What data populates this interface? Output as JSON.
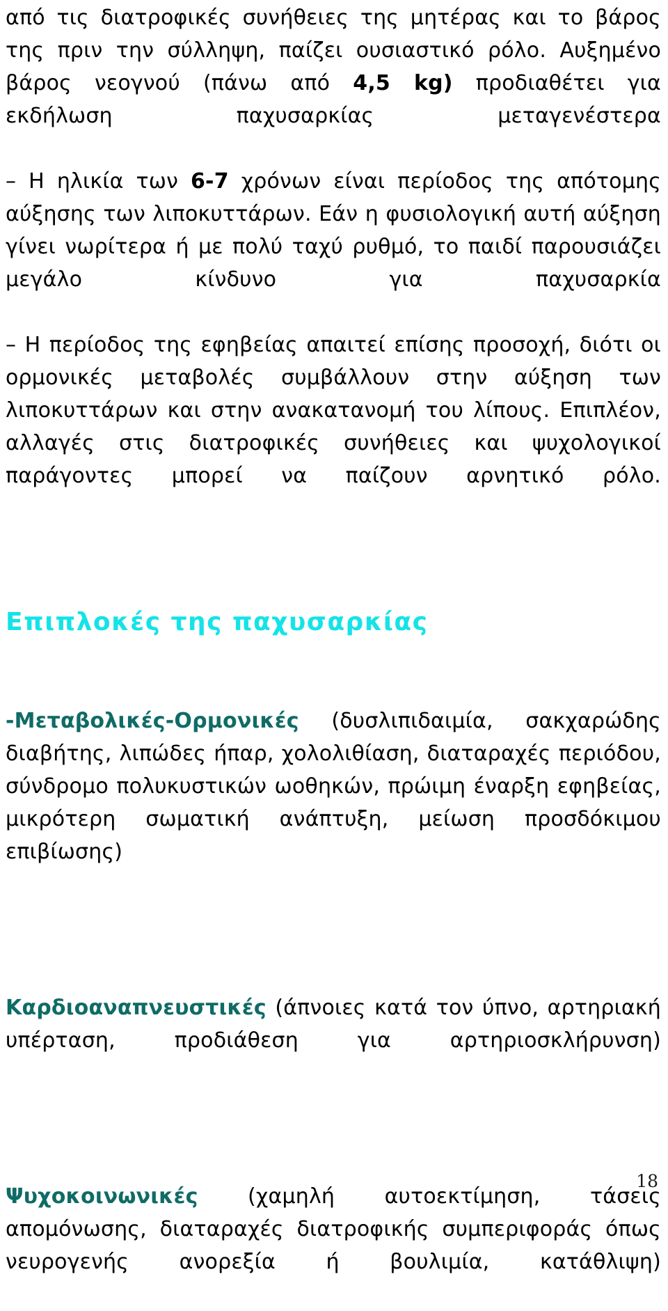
{
  "document": {
    "language": "el",
    "page_number": "18",
    "colors": {
      "body_text": "#000000",
      "section_heading": "#14e3e8",
      "lead_in": "#0f6b66",
      "background": "#ffffff"
    }
  },
  "intro": {
    "part1": "από τις διατροφικές συνήθειες της μητέρας και το βάρος της πριν την σύλληψη, παίζει ουσιαστικό ρόλο. Αυξημένο βάρος νεογνού (πάνω από ",
    "bold1": "4,5 kg)",
    "part2": " προδιαθέτει για εκδήλωση παχυσαρκίας μεταγενέστερα",
    "part3": "– Η ηλικία των ",
    "bold2": "6-7",
    "part4": " χρόνων είναι περίοδος της απότομης αύξησης των λιποκυττάρων. Εάν η φυσιολογική αυτή αύξηση γίνει νωρίτερα ή με πολύ ταχύ ρυθμό, το παιδί παρουσιάζει μεγάλο κίνδυνο για παχυσαρκία",
    "part5": "– Η περίοδος της εφηβείας απαιτεί επίσης προσοχή, διότι οι ορμονικές μεταβολές συμβάλλουν στην αύξηση των λιποκυττάρων και στην ανακατανομή του λίπους. Επιπλέον, αλλαγές στις διατροφικές συνήθειες και ψυχολογικοί παράγοντες μπορεί να παίζουν αρνητικό ρόλο."
  },
  "section": {
    "heading": "Επιπλοκές της παχυσαρκίας"
  },
  "complications": [
    {
      "lead": "-Μεταβολικές-Ορμονικές",
      "body": " (δυσλιπιδαιμία, σακχαρώδης διαβήτης, λιπώδες ήπαρ, χολολιθίαση, διαταραχές περιόδου, σύνδρομο πολυκυστικών ωοθηκών, πρώιμη έναρξη εφηβείας, μικρότερη σωματική ανάπτυξη, μείωση προσδόκιμου επιβίωσης)"
    },
    {
      "lead": "Καρδιοαναπνευστικές",
      "body": " (άπνοιες κατά τον ύπνο, αρτηριακή υπέρταση, προδιάθεση για αρτηριοσκλήρυνση)"
    },
    {
      "lead": "Ψυχοκοινωνικές",
      "body": " (χαμηλή αυτοεκτίμηση, τάσεις απομόνωσης, διαταραχές διατροφικής συμπεριφοράς όπως νευρογενής ανορεξία ή βουλιμία, κατάθλιψη)"
    }
  ]
}
